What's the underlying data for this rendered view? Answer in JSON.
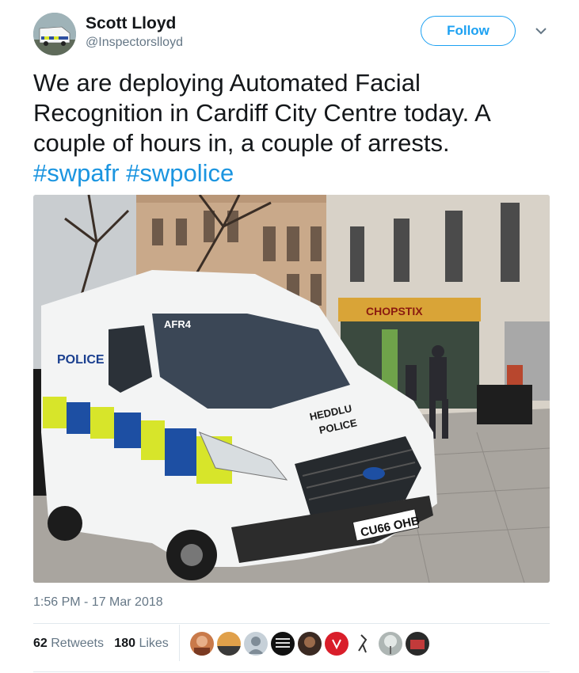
{
  "author": {
    "name": "Scott Lloyd",
    "handle": "@Inspectorslloyd"
  },
  "follow_label": "Follow",
  "tweet": {
    "line1": "We are deploying Automated Facial",
    "line2": "Recognition in Cardiff City Centre today. A",
    "line3": "couple of hours in, a couple of arrests.",
    "hashtag1": "#swpafr",
    "hashtag2": "#swpolice"
  },
  "photo": {
    "van_roof_label": "AFR4",
    "van_side_label": "POLICE",
    "van_hood_line1": "HEDDLU",
    "van_hood_line2": "POLICE",
    "plate": "CU66 OHB",
    "shop_sign": "CHOPSTIX"
  },
  "timestamp": "1:56 PM - 17 Mar 2018",
  "stats": {
    "retweets_count": "62",
    "retweets_label": "Retweets",
    "likes_count": "180",
    "likes_label": "Likes"
  },
  "colors": {
    "accent": "#1da1f2",
    "hashtag": "#1b95e0",
    "muted": "#657786"
  }
}
